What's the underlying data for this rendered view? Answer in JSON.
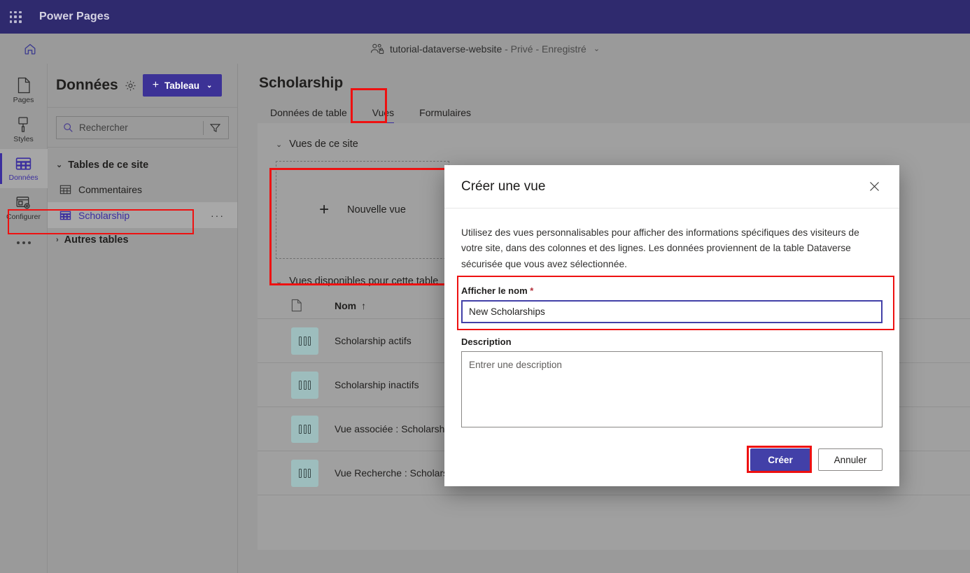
{
  "brand": {
    "waffle_icon": "app-launcher-grid-icon",
    "title": "Power Pages"
  },
  "sitebar": {
    "home_icon": "home-icon",
    "site_icon": "people-lock-icon",
    "site_name": "tutorial-dataverse-website",
    "site_status": " - Privé - Enregistré",
    "chevron": "⌄"
  },
  "rail": {
    "items": [
      {
        "label": "Pages",
        "icon": "page-icon",
        "selected": false
      },
      {
        "label": "Styles",
        "icon": "brush-icon",
        "selected": false
      },
      {
        "label": "Données",
        "icon": "table-grid-icon",
        "selected": true
      },
      {
        "label": "Configurer",
        "icon": "window-gear-icon",
        "selected": false
      }
    ],
    "overflow": "more-options-icon"
  },
  "panel": {
    "title": "Données",
    "settings_icon": "gear-icon",
    "add_button": {
      "plus": "+",
      "label": "Tableau",
      "chevron": "⌄"
    },
    "search": {
      "placeholder": "Rechercher",
      "value": "",
      "icon": "search-icon"
    },
    "filter_icon": "filter-funnel-icon",
    "tree": {
      "group_site_tables": {
        "label": "Tables de ce site",
        "chevron": "⌄"
      },
      "items": [
        {
          "label": "Commentaires",
          "icon": "table-icon",
          "selected": false
        },
        {
          "label": "Scholarship",
          "icon": "table-icon",
          "selected": true,
          "overflow": "···"
        }
      ],
      "group_other_tables": {
        "label": "Autres tables",
        "chevron": "›"
      }
    }
  },
  "main": {
    "title": "Scholarship",
    "tabs": [
      {
        "label": "Données de table",
        "active": false
      },
      {
        "label": "Vues",
        "active": true
      },
      {
        "label": "Formulaires",
        "active": false
      }
    ],
    "site_views": {
      "heading": "Vues de ce site",
      "chevron": "⌄",
      "new_view": {
        "plus": "+",
        "label": "Nouvelle vue"
      }
    },
    "available_views": {
      "heading": "Vues disponibles pour cette table",
      "chevron": "⌄",
      "columns": {
        "icon": "document-icon",
        "name": "Nom",
        "sort": "↑"
      },
      "rows": [
        {
          "icon": "view-columns-icon",
          "name": "Scholarship actifs"
        },
        {
          "icon": "view-columns-icon",
          "name": "Scholarship inactifs"
        },
        {
          "icon": "view-columns-icon",
          "name": "Vue associée : Scholarship"
        },
        {
          "icon": "view-columns-icon",
          "name": "Vue Recherche : Scholarship"
        }
      ]
    }
  },
  "dialog": {
    "title": "Créer une vue",
    "close_icon": "close-icon",
    "description": "Utilisez des vues personnalisables pour afficher des informations spécifiques des visiteurs de votre site, dans des colonnes et des lignes. Les données proviennent de la table Dataverse sécurisée que vous avez sélectionnée.",
    "name_field": {
      "label": "Afficher le nom",
      "required": "*",
      "value": "New Scholarships"
    },
    "description_field": {
      "label": "Description",
      "placeholder": "Entrer une description",
      "value": ""
    },
    "create_button": "Créer",
    "cancel_button": "Annuler"
  },
  "colors": {
    "brand_purple": "#2f2a6e",
    "accent_purple": "#3c3296",
    "dialog_accent": "#4240a8",
    "highlight_red": "#ee1111",
    "row_icon_teal": "#9dbdbd"
  }
}
